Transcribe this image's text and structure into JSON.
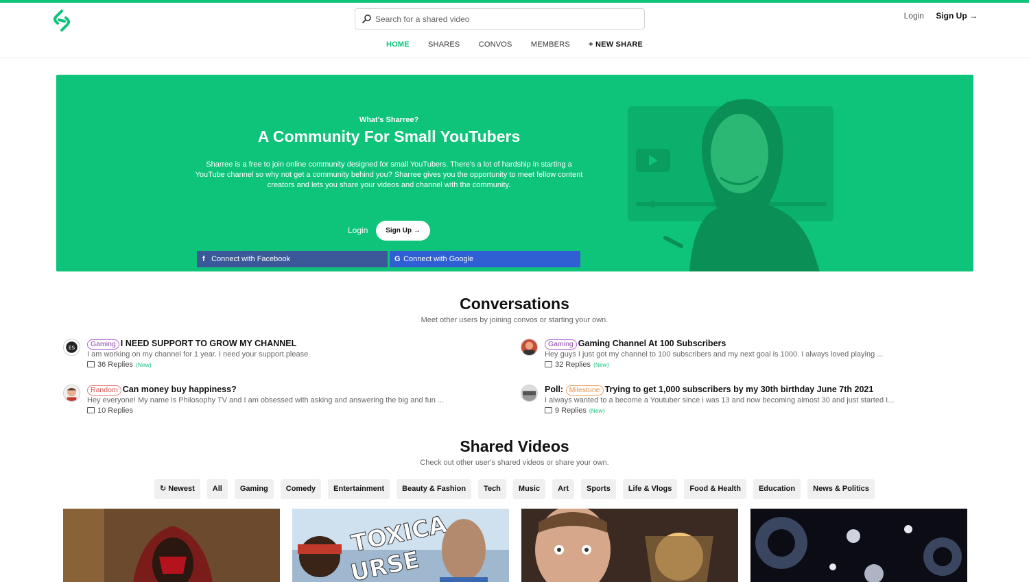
{
  "header": {
    "search_placeholder": "Search for a shared video",
    "login": "Login",
    "signup": "Sign Up →",
    "nav": [
      {
        "label": "HOME",
        "active": true
      },
      {
        "label": "SHARES"
      },
      {
        "label": "CONVOS"
      },
      {
        "label": "MEMBERS"
      },
      {
        "label": "+ NEW SHARE"
      }
    ]
  },
  "hero": {
    "kicker": "What's Sharree?",
    "title": "A Community For Small YouTubers",
    "description": "Sharree is a free to join online community designed for small YouTubers. There's a lot of hardship in starting a YouTube channel so why not get a community behind you? Sharree gives you the opportunity to meet fellow content creators and lets you share your videos and channel with the community.",
    "login": "Login",
    "signup": "Sign Up →",
    "facebook": "Connect with Facebook",
    "google": "Connect with Google"
  },
  "conversations": {
    "title": "Conversations",
    "subtitle": "Meet other users by joining convos or starting your own.",
    "items": [
      {
        "tag": "Gaming",
        "prefix": "",
        "title": "I NEED SUPPORT TO GROW MY CHANNEL",
        "excerpt": "I am working on my channel for 1 year. I need your support.please",
        "replies": "36 Replies",
        "new": "(New)"
      },
      {
        "tag": "Gaming",
        "prefix": "",
        "title": "Gaming Channel At 100 Subscribers",
        "excerpt": "Hey guys I just got my channel to 100 subscribers and my next goal is 1000. I always loved playing ...",
        "replies": "32 Replies",
        "new": "(New)"
      },
      {
        "tag": "Random",
        "prefix": "",
        "title": "Can money buy happiness?",
        "excerpt": "Hey everyone! My name is Philosophy TV and I am obsessed with asking and answering the big and fun ...",
        "replies": "10 Replies",
        "new": ""
      },
      {
        "tag": "Milestone",
        "prefix": "Poll:",
        "title": "Trying to get 1,000 subscribers by my 30th birthday June 7th 2021",
        "excerpt": "I always wanted to a become a Youtuber since i was 13 and now becoming almost 30 and just started I...",
        "replies": "9 Replies",
        "new": "(New)"
      }
    ]
  },
  "shared": {
    "title": "Shared Videos",
    "subtitle": "Check out other user's shared videos or share your own.",
    "filters": [
      "Newest",
      "All",
      "Gaming",
      "Comedy",
      "Entertainment",
      "Beauty & Fashion",
      "Tech",
      "Music",
      "Art",
      "Sports",
      "Life & Vlogs",
      "Food & Health",
      "Education",
      "News & Politics"
    ]
  },
  "colors": {
    "accent": "#0ec37a",
    "facebook": "#3b5998",
    "google": "#2f5fd3"
  }
}
